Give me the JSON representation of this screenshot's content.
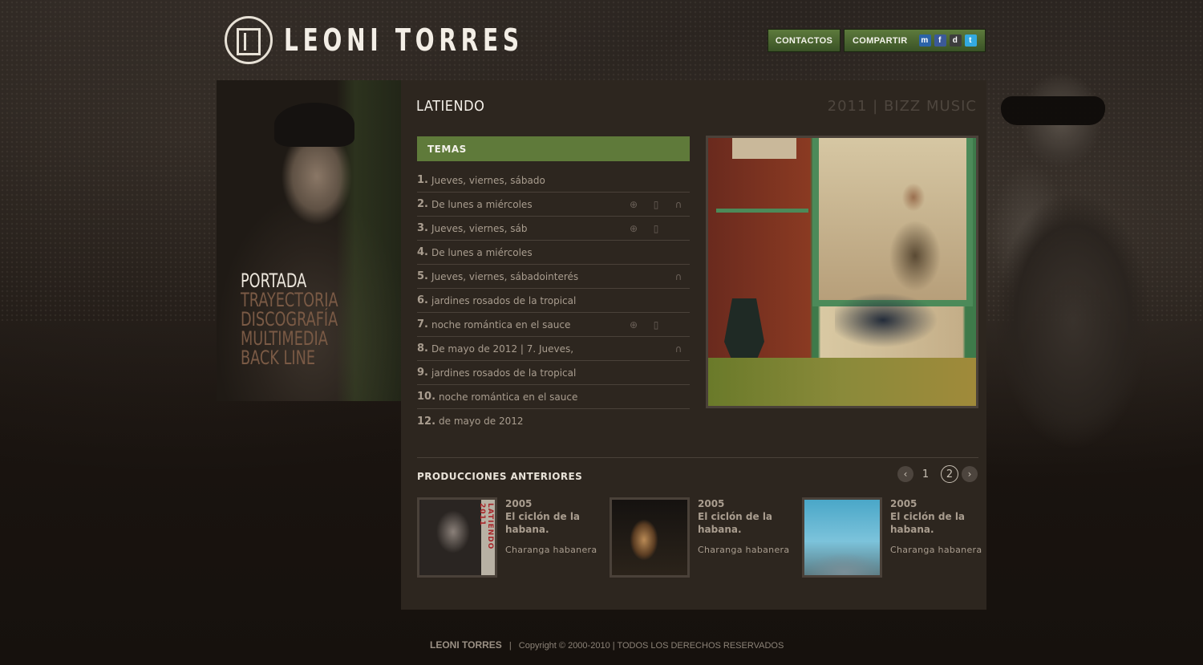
{
  "header": {
    "logo_text": "LEONI TORRES",
    "nav": {
      "contact_label": "CONTACTOS",
      "share_label": "COMPARTIR",
      "share_icons": [
        {
          "name": "myspace-icon",
          "glyph": "m",
          "color": "#2b63a8"
        },
        {
          "name": "facebook-icon",
          "glyph": "f",
          "color": "#3b5998"
        },
        {
          "name": "delicious-icon",
          "glyph": "d",
          "color": "#3d3d3d"
        },
        {
          "name": "twitter-icon",
          "glyph": "t",
          "color": "#33a9e0"
        }
      ]
    }
  },
  "sidebar": {
    "items": [
      {
        "label": "PORTADA",
        "active": true
      },
      {
        "label": "TRAYECTORIA",
        "active": false
      },
      {
        "label": "DISCOGRAFÍA",
        "active": false
      },
      {
        "label": "MULTIMEDIA",
        "active": false
      },
      {
        "label": "BACK LINE",
        "active": false
      }
    ]
  },
  "album": {
    "title": "LATIENDO",
    "meta": "2011 | BIZZ MUSIC",
    "tracks_header": "TEMAS",
    "tracks": [
      {
        "num": "1.",
        "title": "Jueves, viernes, sábado",
        "video": false,
        "download": false,
        "listen": false
      },
      {
        "num": "2.",
        "title": "De lunes a miércoles",
        "video": true,
        "download": true,
        "listen": true
      },
      {
        "num": "3.",
        "title": "Jueves, viernes, sáb",
        "video": true,
        "download": true,
        "listen": false
      },
      {
        "num": "4.",
        "title": "De lunes a miércoles",
        "video": false,
        "download": false,
        "listen": false
      },
      {
        "num": "5.",
        "title": "Jueves, viernes, sábadointerés",
        "video": false,
        "download": false,
        "listen": true
      },
      {
        "num": "6.",
        "title": "jardines rosados de la tropical",
        "video": false,
        "download": false,
        "listen": false
      },
      {
        "num": "7.",
        "title": "noche romántica en el sauce",
        "video": true,
        "download": true,
        "listen": false
      },
      {
        "num": "8.",
        "title": "De mayo de 2012 | 7. Jueves,",
        "video": false,
        "download": false,
        "listen": true
      },
      {
        "num": "9.",
        "title": "jardines rosados de la tropical",
        "video": false,
        "download": false,
        "listen": false
      },
      {
        "num": "10.",
        "title": "noche romántica en el sauce",
        "video": false,
        "download": false,
        "listen": false
      },
      {
        "num": "12.",
        "title": "de mayo de 2012",
        "video": false,
        "download": false,
        "listen": false
      }
    ]
  },
  "previous": {
    "title": "PRODUCCIONES ANTERIORES",
    "pager": {
      "prev_glyph": "‹",
      "next_glyph": "›",
      "pages": [
        "1",
        "2"
      ],
      "current": "2"
    },
    "items": [
      {
        "year": "2005",
        "name": "El ciclón de la habana.",
        "artist": "Charanga habanera",
        "thumb_text": "LATIENDO 2011"
      },
      {
        "year": "2005",
        "name": "El ciclón de la habana.",
        "artist": "Charanga habanera"
      },
      {
        "year": "2005",
        "name": "El ciclón de la habana.",
        "artist": "Charanga habanera"
      }
    ]
  },
  "footer": {
    "brand": "LEONI TORRES",
    "separator": "|",
    "copyright": "Copyright  © 2000-2010 | TODOS LOS DERECHOS RESERVADOS"
  },
  "colors": {
    "accent_green": "#5f7a3a",
    "panel_bg": "#2d261f",
    "text_muted": "#a99d8f",
    "menu_inactive": "#7a5a45"
  }
}
